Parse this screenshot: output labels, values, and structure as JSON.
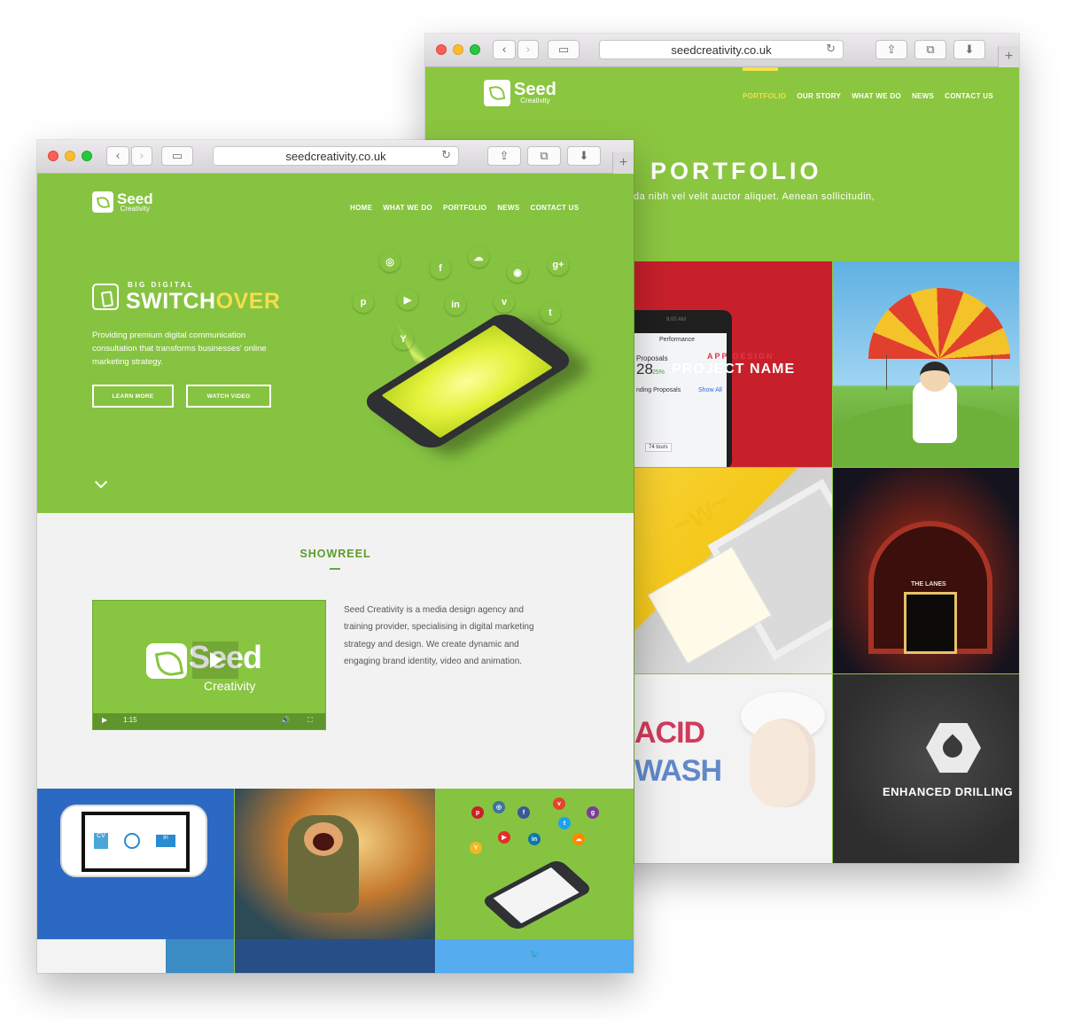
{
  "back_window": {
    "url": "seedcreativity.co.uk",
    "logo": {
      "name": "Seed",
      "tagline": "Creativity"
    },
    "nav": [
      "PORTFOLIO",
      "OUR STORY",
      "WHAT WE DO",
      "NEWS",
      "CONTACT US"
    ],
    "hero_title": "PORTFOLIO",
    "hero_subtitle": "da nibh vel velit auctor aliquet. Aenean sollicitudin,",
    "tiles": {
      "app_design": {
        "kicker": "APP DESIGN",
        "name": "PROJECT NAME",
        "time": "9:00 AM",
        "app": "Performance",
        "metric": "28",
        "metric_label": "Proposals",
        "change": "25%",
        "pending": "nding Proposals",
        "show_all": "Show All",
        "tours": "74 tours"
      },
      "venue": {
        "sign": "THE LANES"
      },
      "book": {
        "word1": "ACID",
        "word2": "WASH"
      },
      "drilling": {
        "title": "ENHANCED DRILLING"
      }
    }
  },
  "front_window": {
    "url": "seedcreativity.co.uk",
    "logo": {
      "name": "Seed",
      "tagline": "Creativity"
    },
    "nav": [
      "HOME",
      "WHAT WE DO",
      "PORTFOLIO",
      "NEWS",
      "CONTACT US"
    ],
    "hero": {
      "kicker": "BIG DIGITAL",
      "title_white": "SWITCH",
      "title_yellow": "OVER",
      "copy": "Providing premium digital communication consultation that transforms businesses' online marketing strategy.",
      "learn_more": "LEARN MORE",
      "watch_video": "WATCH VIDEO"
    },
    "social_icons": [
      {
        "name": "instagram-icon",
        "glyph": "◎",
        "color": "#3f729b"
      },
      {
        "name": "facebook-icon",
        "glyph": "f",
        "color": "#3b5998"
      },
      {
        "name": "soundcloud-icon",
        "glyph": "☁",
        "color": "#ff8800"
      },
      {
        "name": "rss-icon",
        "glyph": "◉",
        "color": "#e8452c"
      },
      {
        "name": "google-plus-icon",
        "glyph": "g+",
        "color": "#7a3e98"
      },
      {
        "name": "pinterest-icon",
        "glyph": "p",
        "color": "#cb2027"
      },
      {
        "name": "youtube-icon",
        "glyph": "▶",
        "color": "#e52d27"
      },
      {
        "name": "linkedin-icon",
        "glyph": "in",
        "color": "#0e76a8"
      },
      {
        "name": "vimeo-icon",
        "glyph": "v",
        "color": "#e3452b"
      },
      {
        "name": "twitter-icon",
        "glyph": "t",
        "color": "#1da1f2"
      },
      {
        "name": "yahoo-icon",
        "glyph": "Y",
        "color": "#f2b824"
      }
    ],
    "showreel": {
      "title": "SHOWREEL",
      "video_logo": "Seed",
      "video_tagline": "Creativity",
      "video_time": "1:15",
      "description": "Seed Creativity is a media design agency and training provider, specialising in digital marketing strategy and design. We create dynamic and engaging brand identity, video and animation."
    },
    "phone_labels": [
      "CV",
      "in"
    ]
  }
}
